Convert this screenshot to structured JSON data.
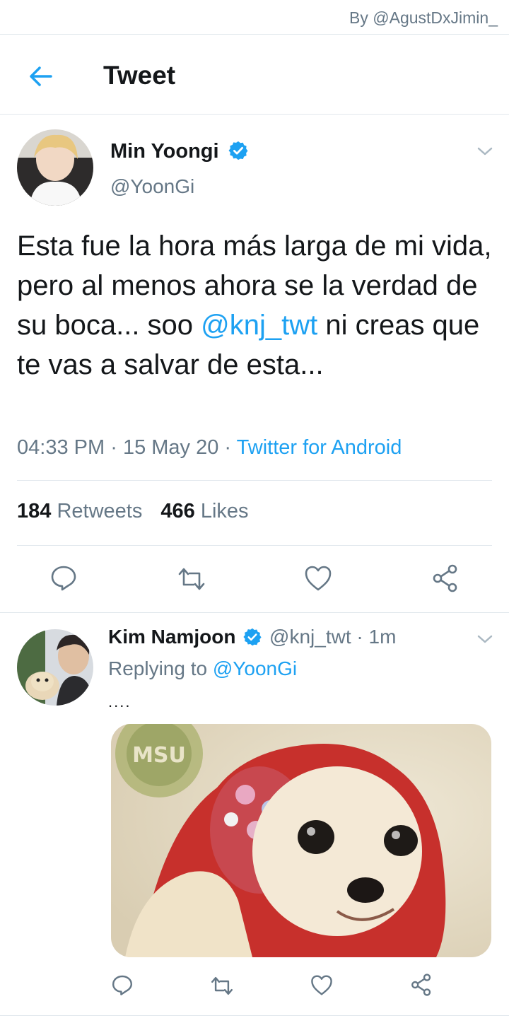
{
  "credit": "By @AgustDxJimin_",
  "header": {
    "title": "Tweet",
    "back_icon": "arrow-left-icon"
  },
  "main_tweet": {
    "author_name": "Min Yoongi",
    "author_handle": "@YoonGi",
    "verified": true,
    "text_before_mention": "Esta fue la hora más larga de mi vida, pero al menos ahora se la verdad de su boca... soo ",
    "mention": "@knj_twt",
    "text_after_mention": " ni creas que te vas a salvar de esta...",
    "time": "04:33 PM",
    "date": "15 May 20",
    "source": "Twitter for Android",
    "separator": "·",
    "retweets_count": "184",
    "retweets_label": "Retweets",
    "likes_count": "466",
    "likes_label": "Likes"
  },
  "reply_tweet": {
    "author_name": "Kim Namjoon",
    "author_handle": "@knj_twt",
    "verified": true,
    "age": "1m",
    "separator": "·",
    "replying_prefix": "Replying to",
    "replying_to": "@YoonGi",
    "text": "....",
    "media_watermark": "MSU"
  },
  "colors": {
    "accent": "#1da1f2",
    "muted": "#657786",
    "text": "#14171a",
    "divider": "#e1e8ed"
  }
}
